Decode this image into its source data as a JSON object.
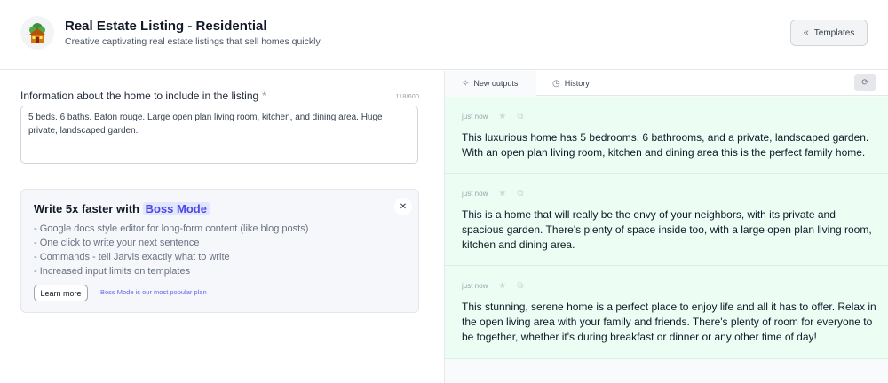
{
  "header": {
    "title": "Real Estate Listing - Residential",
    "subtitle": "Creative captivating real estate listings that sell homes quickly.",
    "templates_label": "Templates",
    "app_icon": "house-icon"
  },
  "form": {
    "field_label": "Information about the home to include in the listing",
    "required_mark": "*",
    "char_count": "118/600",
    "input_value": "5 beds. 6 baths. Baton rouge. Large open plan living room, kitchen, and dining area. Huge private, landscaped garden."
  },
  "boss": {
    "title_prefix": "Write 5x faster with",
    "title_highlight": "Boss Mode",
    "features": [
      "- Google docs style editor for long-form content (like blog posts)",
      "- One click to write your next sentence",
      "- Commands - tell Jarvis exactly what to write",
      "- Increased input limits on templates"
    ],
    "learn_more_label": "Learn more",
    "note": "Boss Mode is our most popular plan"
  },
  "outputs_panel": {
    "tabs": [
      {
        "label": "New outputs",
        "icon": "sparkle-icon"
      },
      {
        "label": "History",
        "icon": "clock-icon"
      }
    ],
    "items": [
      {
        "time": "just now",
        "text": "This luxurious home has 5 bedrooms, 6 bathrooms, and a private, landscaped garden. With an open plan living room, kitchen and dining area this is the perfect family home."
      },
      {
        "time": "just now",
        "text": "This is a home that will really be the envy of your neighbors, with its private and spacious garden. There's plenty of space inside too, with a large open plan living room, kitchen and dining area."
      },
      {
        "time": "just now",
        "text": "This stunning, serene home is a perfect place to enjoy life and all it has to offer. Relax in the open living area with your family and friends. There's plenty of room for everyone to be together, whether it's during breakfast or dinner or any other time of day!"
      }
    ]
  },
  "colors": {
    "output_bg": "#ecfdf3",
    "accent": "#4f46e5"
  }
}
